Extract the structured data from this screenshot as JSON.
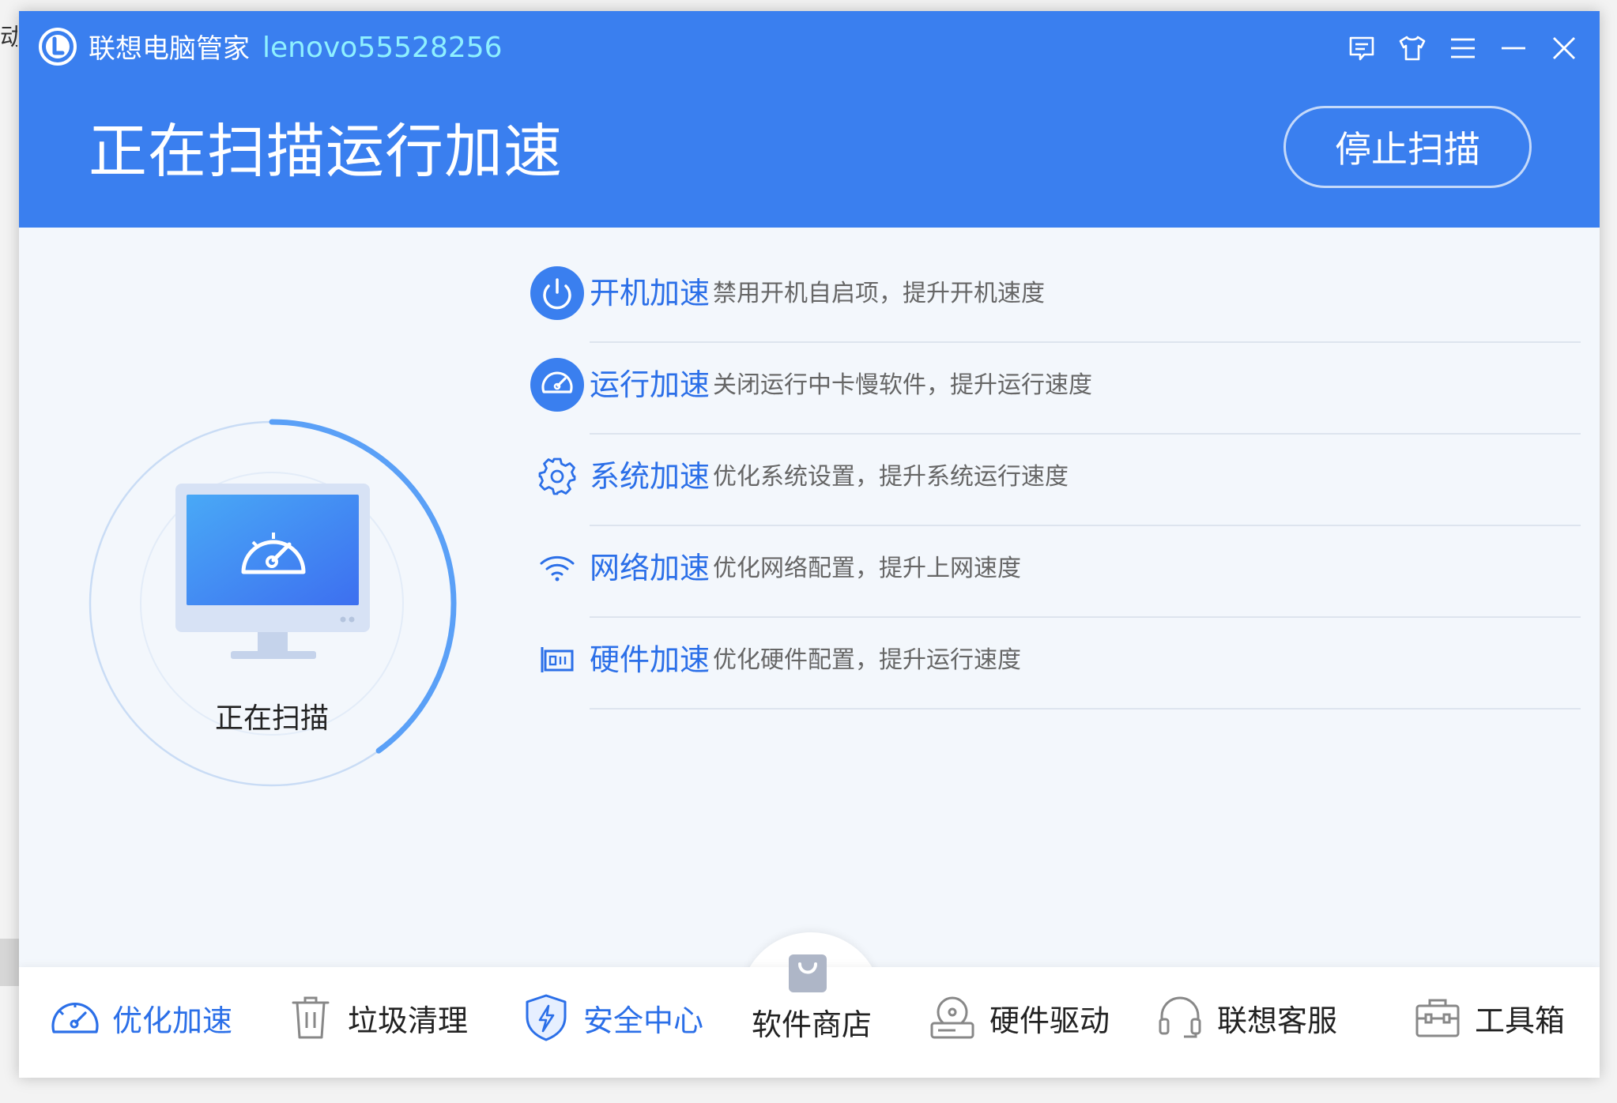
{
  "desktop": {
    "edge_text": "动"
  },
  "app": {
    "brand": "联想电脑管家",
    "user": "lenovo55528256"
  },
  "header": {
    "title": "正在扫描运行加速",
    "stop_button": "停止扫描"
  },
  "scan": {
    "label": "正在扫描",
    "progress_percent": 40
  },
  "items": [
    {
      "name": "开机加速",
      "desc": "禁用开机自启项，提升开机速度",
      "icon": "power-icon"
    },
    {
      "name": "运行加速",
      "desc": "关闭运行中卡慢软件，提升运行速度",
      "icon": "speedometer-icon"
    },
    {
      "name": "系统加速",
      "desc": "优化系统设置，提升系统运行速度",
      "icon": "gear-icon"
    },
    {
      "name": "网络加速",
      "desc": "优化网络配置，提升上网速度",
      "icon": "wifi-icon"
    },
    {
      "name": "硬件加速",
      "desc": "优化硬件配置，提升运行速度",
      "icon": "hardware-icon"
    }
  ],
  "nav": [
    {
      "label": "优化加速",
      "icon": "speedometer-icon",
      "active": true
    },
    {
      "label": "垃圾清理",
      "icon": "trash-icon",
      "active": false
    },
    {
      "label": "安全中心",
      "icon": "shield-icon",
      "active": false
    },
    {
      "label": "软件商店",
      "icon": "shopping-bag-icon",
      "active": false
    },
    {
      "label": "硬件驱动",
      "icon": "disk-drive-icon",
      "active": false
    },
    {
      "label": "联想客服",
      "icon": "headset-icon",
      "active": false
    },
    {
      "label": "工具箱",
      "icon": "toolbox-icon",
      "active": false
    }
  ],
  "colors": {
    "header_blue": "#3a7fef",
    "accent_blue": "#2b6fe8",
    "user_cyan": "#8ef0ff"
  }
}
